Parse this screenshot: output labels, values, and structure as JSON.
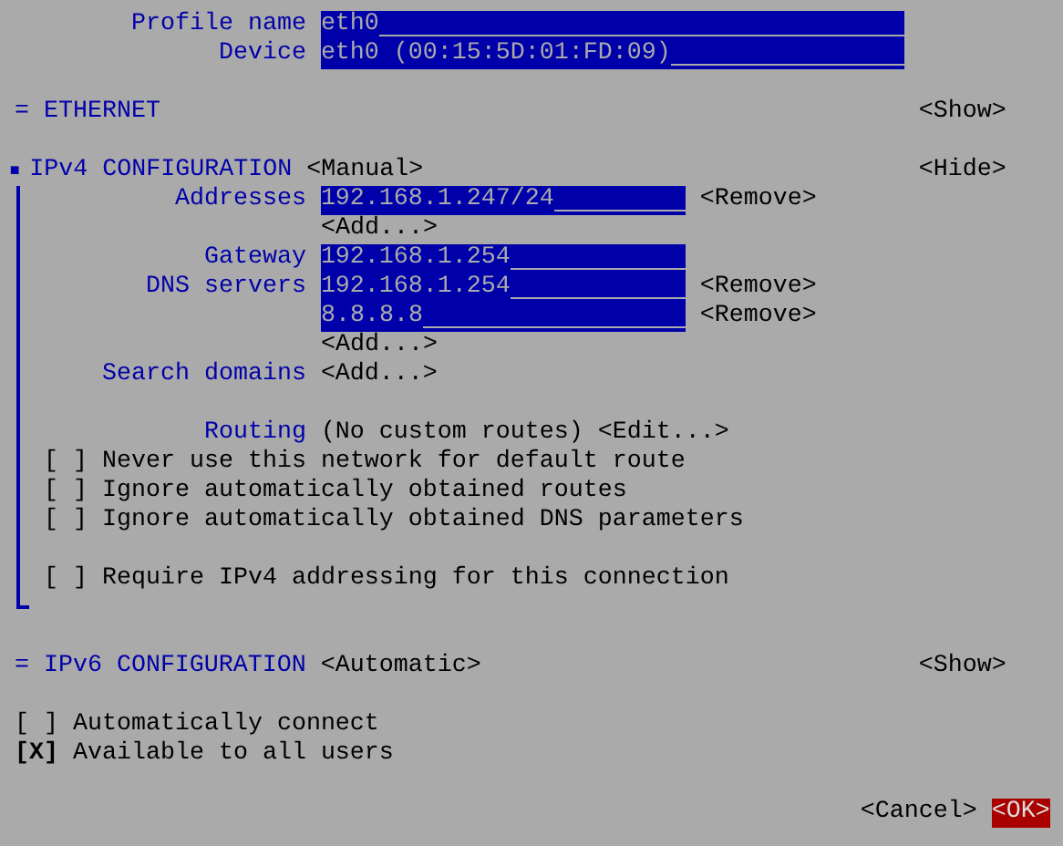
{
  "profile": [
    {
      "label": "Profile name",
      "value": "eth0"
    },
    {
      "label": "Device",
      "value": "eth0 (00:15:5D:01:FD:09)"
    }
  ],
  "sections": [
    {
      "marker": "=",
      "title": "ETHERNET",
      "expanded": false,
      "toggle": "<Show>"
    },
    {
      "marker": "■",
      "title": "IPv4 CONFIGURATION",
      "mode": "<Manual>",
      "expanded": true,
      "toggle": "<Hide>",
      "rows": [
        {
          "kind": "field",
          "label": "Addresses",
          "value": "192.168.1.247/24",
          "action": "<Remove>"
        },
        {
          "kind": "button",
          "text": "<Add...>"
        },
        {
          "kind": "field",
          "label": "Gateway",
          "value": "192.168.1.254"
        },
        {
          "kind": "field",
          "label": "DNS servers",
          "value": "192.168.1.254",
          "action": "<Remove>"
        },
        {
          "kind": "field",
          "value": "8.8.8.8",
          "action": "<Remove>"
        },
        {
          "kind": "button",
          "text": "<Add...>"
        },
        {
          "kind": "button",
          "label": "Search domains",
          "text": "<Add...>"
        },
        {
          "kind": "blank"
        },
        {
          "kind": "routing",
          "label": "Routing",
          "text": "(No custom routes)",
          "action": "<Edit...>"
        },
        {
          "kind": "checkbox",
          "box": "[ ]",
          "checked": false,
          "text": "Never use this network for default route"
        },
        {
          "kind": "checkbox",
          "box": "[ ]",
          "checked": false,
          "text": "Ignore automatically obtained routes"
        },
        {
          "kind": "checkbox",
          "box": "[ ]",
          "checked": false,
          "text": "Ignore automatically obtained DNS parameters"
        },
        {
          "kind": "blank"
        },
        {
          "kind": "checkbox",
          "box": "[ ]",
          "checked": false,
          "text": "Require IPv4 addressing for this connection"
        }
      ]
    },
    {
      "marker": "=",
      "title": "IPv6 CONFIGURATION",
      "mode": "<Automatic>",
      "expanded": false,
      "toggle": "<Show>"
    }
  ],
  "options": [
    {
      "box": "[ ]",
      "checked": false,
      "text": "Automatically connect"
    },
    {
      "box": "[X]",
      "checked": true,
      "text": "Available to all users"
    }
  ],
  "buttons": [
    {
      "label": "<Cancel>",
      "selected": false
    },
    {
      "label": "<OK>",
      "selected": true
    }
  ]
}
